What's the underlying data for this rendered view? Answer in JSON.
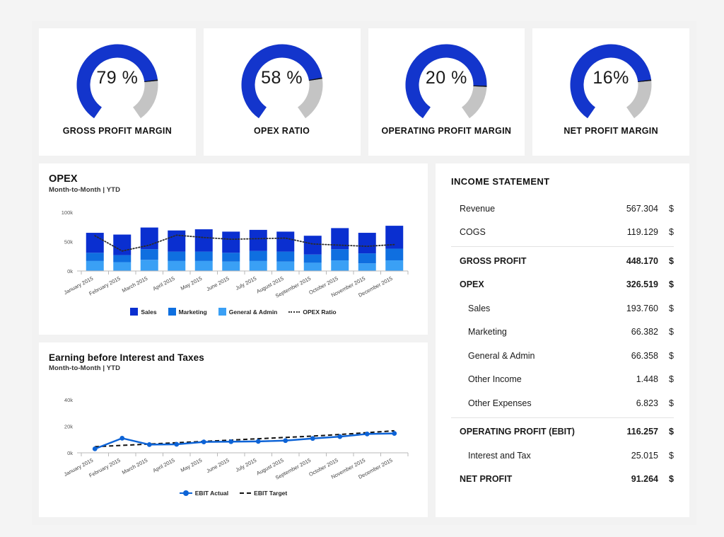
{
  "kpis": [
    {
      "label": "GROSS PROFIT MARGIN",
      "value": "79 %",
      "fill_pct": 79
    },
    {
      "label": "OPEX RATIO",
      "value": "58 %",
      "fill_pct": 78
    },
    {
      "label": "OPERATING PROFIT MARGIN",
      "value": "20 %",
      "fill_pct": 82
    },
    {
      "label": "NET PROFIT MARGIN",
      "value": "16%",
      "fill_pct": 79
    }
  ],
  "colors": {
    "gauge_blue": "#1335cc",
    "gauge_track": "#c4c4c4",
    "sales": "#0a2fd0",
    "marketing": "#0f6fe0",
    "general_admin": "#3aa0f5",
    "ebit_actual": "#0d63d6",
    "ebit_target": "#111111",
    "page_bg": "#f2f2f2",
    "card_bg": "#ffffff"
  },
  "opex_chart": {
    "title": "OPEX",
    "subtitle": "Month-to-Month | YTD",
    "legend": [
      {
        "label": "Sales",
        "type": "swatch"
      },
      {
        "label": "Marketing",
        "type": "swatch"
      },
      {
        "label": "General & Admin",
        "type": "swatch"
      },
      {
        "label": "OPEX Ratio",
        "type": "dotted-line"
      }
    ]
  },
  "ebit_chart": {
    "title": "Earning before Interest and Taxes",
    "subtitle": "Month-to-Month | YTD",
    "legend": [
      {
        "label": "EBIT Actual",
        "type": "marker-line"
      },
      {
        "label": "EBIT Target",
        "type": "dashed-line"
      }
    ]
  },
  "income_statement": {
    "title": "INCOME STATEMENT",
    "currency": "$",
    "rows": [
      {
        "name": "Revenue",
        "amount": "567.304",
        "style": "normal"
      },
      {
        "name": "COGS",
        "amount": "119.129",
        "style": "normal"
      },
      {
        "name": "GROSS PROFIT",
        "amount": "448.170",
        "style": "total",
        "divider_before": true
      },
      {
        "name": "OPEX",
        "amount": "326.519",
        "style": "total"
      },
      {
        "name": "Sales",
        "amount": "193.760",
        "style": "indent"
      },
      {
        "name": "Marketing",
        "amount": "66.382",
        "style": "indent"
      },
      {
        "name": "General & Admin",
        "amount": "66.358",
        "style": "indent"
      },
      {
        "name": "Other Income",
        "amount": "1.448",
        "style": "indent"
      },
      {
        "name": "Other Expenses",
        "amount": "6.823",
        "style": "indent"
      },
      {
        "name": "OPERATING PROFIT (EBIT)",
        "amount": "116.257",
        "style": "total",
        "divider_before": true
      },
      {
        "name": "Interest and Tax",
        "amount": "25.015",
        "style": "indent"
      },
      {
        "name": "NET PROFIT",
        "amount": "91.264",
        "style": "total"
      }
    ]
  },
  "chart_data": [
    {
      "type": "bar",
      "title": "OPEX",
      "subtitle": "Month-to-Month | YTD",
      "stacked": true,
      "xlabel": "",
      "ylabel": "",
      "ylim": [
        0,
        100
      ],
      "ytick_labels": [
        "0k",
        "50k",
        "100k"
      ],
      "yticks": [
        0,
        50,
        100
      ],
      "grid": false,
      "legend_position": "bottom",
      "categories": [
        "January 2015",
        "February 2015",
        "March 2015",
        "April 2015",
        "May 2015",
        "June 2015",
        "July 2015",
        "August 2015",
        "September 2015",
        "October 2015",
        "November 2015",
        "December 2015"
      ],
      "series": [
        {
          "name": "General & Admin",
          "values": [
            17,
            15,
            19,
            17,
            17,
            16,
            17,
            16,
            14,
            18,
            13,
            18
          ]
        },
        {
          "name": "Marketing",
          "values": [
            14,
            12,
            18,
            16,
            16,
            15,
            17,
            17,
            14,
            19,
            17,
            20
          ]
        },
        {
          "name": "Sales",
          "values": [
            34,
            35,
            37,
            36,
            38,
            36,
            36,
            34,
            32,
            36,
            35,
            39
          ]
        }
      ],
      "overlay": {
        "name": "OPEX Ratio",
        "style": "dotted",
        "values": [
          60,
          34,
          44,
          61,
          57,
          54,
          55,
          56,
          46,
          44,
          42,
          45
        ]
      }
    },
    {
      "type": "line",
      "title": "Earning before Interest and Taxes",
      "subtitle": "Month-to-Month | YTD",
      "xlabel": "",
      "ylabel": "",
      "ylim": [
        0,
        48
      ],
      "ytick_labels": [
        "0k",
        "20k",
        "40k"
      ],
      "yticks": [
        0,
        20,
        40
      ],
      "grid": false,
      "legend_position": "bottom",
      "categories": [
        "January 2015",
        "February 2015",
        "March 2015",
        "April 2015",
        "May 2015",
        "June 2015",
        "July 2015",
        "August 2015",
        "September 2015",
        "October 2015",
        "November 2015",
        "December 2015"
      ],
      "series": [
        {
          "name": "EBIT Actual",
          "style": "solid-markers",
          "values": [
            3.0,
            11.0,
            6.2,
            6.4,
            8.2,
            8.4,
            8.6,
            9.2,
            10.8,
            12.2,
            14.2,
            14.6
          ]
        },
        {
          "name": "EBIT Target",
          "style": "dashed",
          "values": [
            4.6,
            5.6,
            6.6,
            7.6,
            8.6,
            9.6,
            10.6,
            11.6,
            12.6,
            13.8,
            15.2,
            16.6
          ]
        }
      ]
    }
  ]
}
